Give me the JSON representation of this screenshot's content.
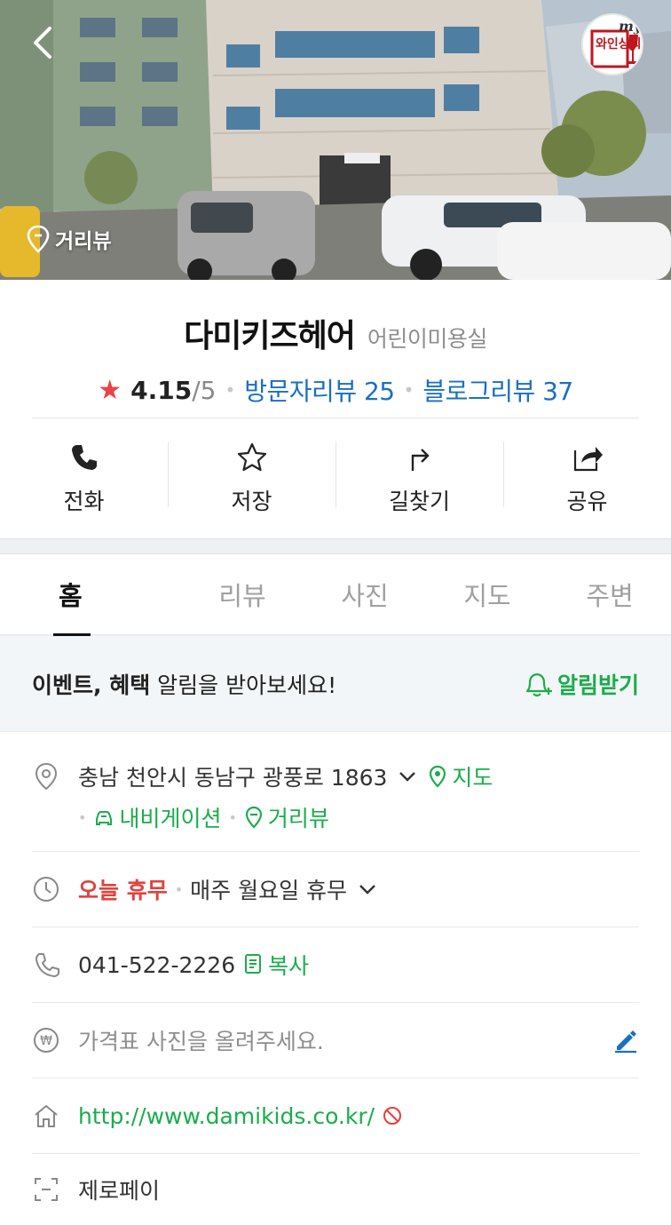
{
  "header": {
    "back_icon": "chevron-left-icon",
    "logo_text_top": "my",
    "logo_text_main": "와인상회",
    "street_view_label": "거리뷰"
  },
  "place": {
    "name": "다미키즈헤어",
    "category": "어린이미용실",
    "rating": "4.15",
    "rating_max": "/5",
    "visitor_reviews": "방문자리뷰 25",
    "blog_reviews": "블로그리뷰 37"
  },
  "actions": [
    {
      "label": "전화",
      "icon": "phone-icon"
    },
    {
      "label": "저장",
      "icon": "star-outline-icon"
    },
    {
      "label": "길찾기",
      "icon": "directions-icon"
    },
    {
      "label": "공유",
      "icon": "share-icon"
    }
  ],
  "tabs": [
    "홈",
    "리뷰",
    "사진",
    "지도",
    "주변"
  ],
  "notice": {
    "bold_text": "이벤트, 혜택",
    "text": " 알림을 받아보세요!",
    "button": "알림받기"
  },
  "info": {
    "address": "충남 천안시 동남구 광풍로 1863",
    "map_link": "지도",
    "navi_link": "내비게이션",
    "street_link": "거리뷰",
    "today_status": "오늘 휴무",
    "hours": "매주 월요일 휴무",
    "phone": "041-522-2226",
    "copy_link": "복사",
    "price_prompt": "가격표 사진을 올려주세요.",
    "website": "http://www.damikids.co.kr/",
    "zeropay": "제로페이"
  },
  "colors": {
    "accent_green": "#1aad4b",
    "link_blue": "#1a6fc1",
    "star_red": "#ea4343",
    "closed_red": "#e0423e"
  }
}
